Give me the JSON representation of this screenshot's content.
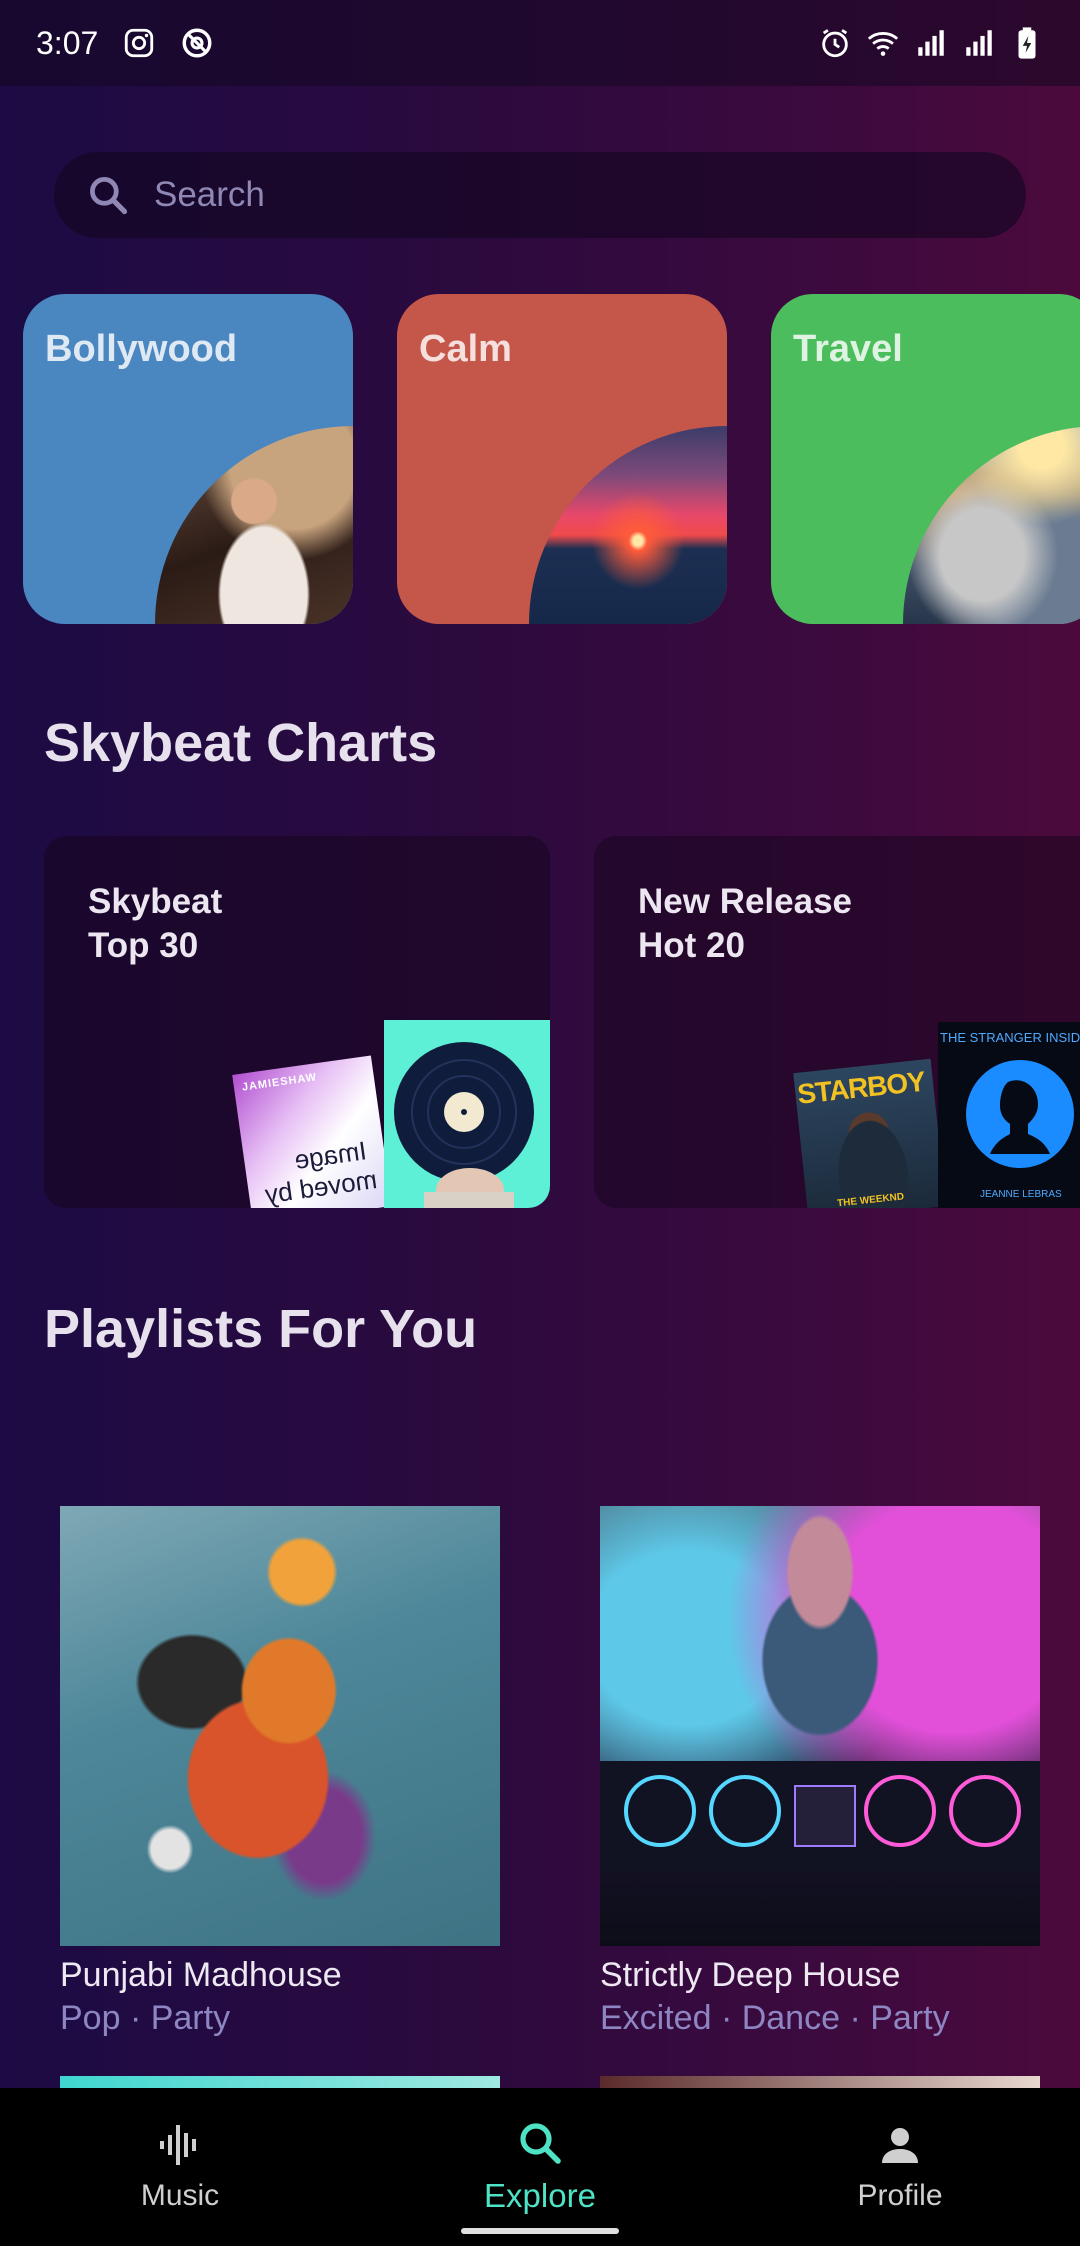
{
  "status_bar": {
    "time": "3:07",
    "left_icons": [
      "instagram-icon",
      "sync-icon"
    ],
    "right_icons": [
      "alarm-icon",
      "wifi-icon",
      "signal-icon",
      "signal-icon",
      "battery-charging-icon"
    ]
  },
  "search": {
    "placeholder": "Search",
    "icon": "search-icon"
  },
  "categories": [
    {
      "label": "Bollywood",
      "color": "#4a86c0"
    },
    {
      "label": "Calm",
      "color": "#c5564a"
    },
    {
      "label": "Travel",
      "color": "#4cbd5d"
    }
  ],
  "charts_section": {
    "title": "Skybeat Charts",
    "cards": [
      {
        "title": "Skybeat\nTop 30",
        "covers": [
          "Image moved by",
          "vinyl-record"
        ]
      },
      {
        "title": "New Release\nHot 20",
        "covers": [
          "STARBOY",
          "THE STRANGER INSIDE YOU"
        ]
      }
    ],
    "cover_text": {
      "starboy_title": "STARBOY",
      "starboy_artist": "THE WEEKND",
      "stranger_title": "THE STRANGER INSIDE YO",
      "stranger_artist": "JEANNE LEBRAS",
      "moved_line1": "Image",
      "moved_line2": "moved by",
      "moved_brand": "JAMIESHAW"
    }
  },
  "playlists_section": {
    "title": "Playlists For You",
    "items": [
      {
        "name": "Punjabi Madhouse",
        "tags": "Pop · Party"
      },
      {
        "name": "Strictly Deep House",
        "tags": "Excited · Dance · Party"
      }
    ]
  },
  "bottom_nav": {
    "items": [
      {
        "label": "Music",
        "icon": "waveform-icon",
        "active": false
      },
      {
        "label": "Explore",
        "icon": "search-icon",
        "active": true
      },
      {
        "label": "Profile",
        "icon": "person-icon",
        "active": false
      }
    ]
  },
  "colors": {
    "accent": "#4fe3c6",
    "tag_text": "#8d86c2"
  }
}
